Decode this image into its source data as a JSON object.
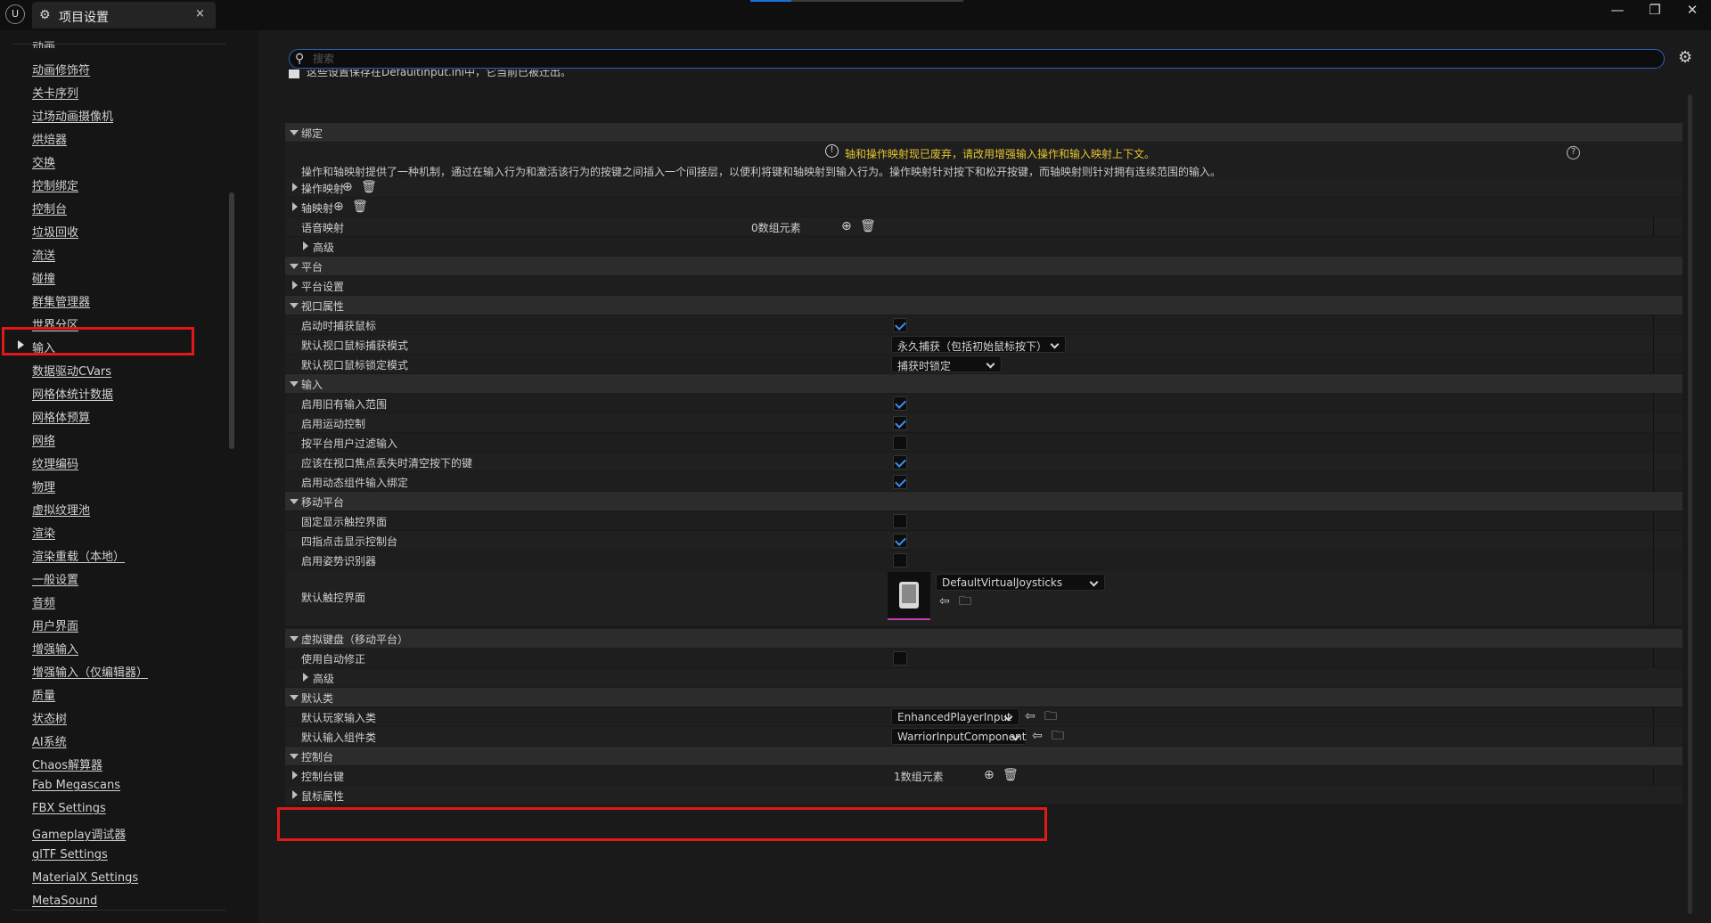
{
  "window": {
    "tab_title": "项目设置",
    "close_glyph": "×",
    "minimize_glyph": "—",
    "restore_glyph": "❐",
    "close_window_glyph": "✕"
  },
  "sidebar": {
    "items": [
      {
        "label": "动画"
      },
      {
        "label": "动画修饰符"
      },
      {
        "label": "关卡序列"
      },
      {
        "label": "过场动画摄像机"
      },
      {
        "label": "烘焙器"
      },
      {
        "label": "交换"
      },
      {
        "label": "控制绑定"
      },
      {
        "label": "控制台"
      },
      {
        "label": "垃圾回收"
      },
      {
        "label": "流送"
      },
      {
        "label": "碰撞"
      },
      {
        "label": "群集管理器"
      },
      {
        "label": "世界分区"
      },
      {
        "label": "输入"
      },
      {
        "label": "数据驱动CVars"
      },
      {
        "label": "网格体统计数据"
      },
      {
        "label": "网格体预算"
      },
      {
        "label": "网络"
      },
      {
        "label": "纹理编码"
      },
      {
        "label": "物理"
      },
      {
        "label": "虚拟纹理池"
      },
      {
        "label": "渲染"
      },
      {
        "label": "渲染重载（本地）"
      },
      {
        "label": "一般设置"
      },
      {
        "label": "音频"
      },
      {
        "label": "用户界面"
      },
      {
        "label": "增强输入"
      },
      {
        "label": "增强输入（仅编辑器）"
      },
      {
        "label": "质量"
      },
      {
        "label": "状态树"
      },
      {
        "label": "AI系统"
      },
      {
        "label": "Chaos解算器"
      },
      {
        "label": "Fab Megascans"
      },
      {
        "label": "FBX Settings"
      },
      {
        "label": "Gameplay调试器"
      },
      {
        "label": "glTF Settings"
      },
      {
        "label": "MaterialX Settings"
      },
      {
        "label": "MetaSound"
      }
    ]
  },
  "search": {
    "placeholder": "搜索",
    "value": ""
  },
  "notice": "这些设置保存在DefaultInput.ini中，它当前已被迁出。",
  "sections": {
    "bindings": {
      "title": "绑定",
      "warning": "轴和操作映射现已废弃，请改用增强输入操作和输入映射上下文。",
      "description": "操作和轴映射提供了一种机制，通过在输入行为和激活该行为的按键之间插入一个间接层，以便利将键和轴映射到输入行为。操作映射针对按下和松开按键，而轴映射则针对拥有连续范围的输入。",
      "action_mappings": "操作映射",
      "axis_mappings": "轴映射",
      "speech_mappings": "语音映射",
      "speech_mappings_value": "0数组元素",
      "advanced": "高级"
    },
    "platform": {
      "title": "平台",
      "settings": "平台设置"
    },
    "viewport": {
      "title": "视口属性",
      "capture_on_launch": "启动时捕获鼠标",
      "capture_mode_label": "默认视口鼠标捕获模式",
      "capture_mode_value": "永久捕获（包括初始鼠标按下）",
      "lock_mode_label": "默认视口鼠标锁定模式",
      "lock_mode_value": "捕获时锁定"
    },
    "input": {
      "title": "输入",
      "legacy_input_scales": "启用旧有输入范围",
      "motion_controls": "启用运动控制",
      "filter_by_platform_user": "按平台用户过滤输入",
      "flush_keys_on_focus_loss": "应该在视口焦点丢失时清空按下的键",
      "dynamic_component_binding": "启用动态组件输入绑定"
    },
    "mobile": {
      "title": "移动平台",
      "always_show_touch": "固定显示触控界面",
      "four_finger_console": "四指点击显示控制台",
      "gesture_recognizer": "启用姿势识别器",
      "default_touch_interface": "默认触控界面",
      "touch_interface_value": "DefaultVirtualJoysticks"
    },
    "virtual_keyboard": {
      "title": "虚拟键盘（移动平台）",
      "autocorrect": "使用自动修正",
      "advanced": "高级"
    },
    "default_classes": {
      "title": "默认类",
      "player_input_label": "默认玩家输入类",
      "player_input_value": "EnhancedPlayerInput",
      "input_component_label": "默认输入组件类",
      "input_component_value": "WarriorInputComponent"
    },
    "console": {
      "title": "控制台",
      "console_keys": "控制台键",
      "console_keys_value": "1数组元素"
    },
    "mouse": {
      "title": "鼠标属性"
    }
  },
  "checkbox_states": {
    "capture_on_launch": true,
    "legacy_input_scales": true,
    "motion_controls": true,
    "filter_by_platform_user": false,
    "flush_keys_on_focus_loss": true,
    "dynamic_component_binding": true,
    "always_show_touch": false,
    "four_finger_console": true,
    "gesture_recognizer": false,
    "autocorrect": false
  },
  "colors": {
    "accent": "#2a62b8",
    "checkmark": "#3b8ef0",
    "warning_text": "#e5c530",
    "highlight": "#e01818"
  }
}
